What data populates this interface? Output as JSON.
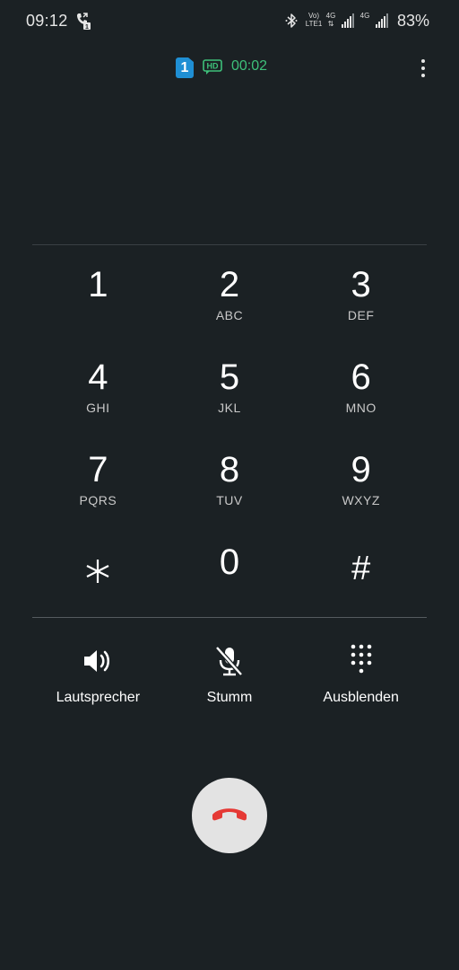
{
  "status_bar": {
    "time": "09:12",
    "volte_line1": "Vo)",
    "volte_line2": "LTE1",
    "network_1": "4G",
    "network_2": "4G",
    "battery": "83%",
    "icons": [
      "call-forward-icon",
      "bluetooth-icon",
      "signal-icon",
      "signal-icon"
    ]
  },
  "call": {
    "sim": "1",
    "hd_label": "HD",
    "timer": "00:02",
    "colors": {
      "timer": "#3ec07a",
      "sim_badge": "#1f8fd4",
      "end_call_icon": "#e53935",
      "end_call_bg": "#e3e3e3",
      "background": "#1b2124"
    }
  },
  "keypad": {
    "keys": [
      {
        "digit": "1",
        "letters": ""
      },
      {
        "digit": "2",
        "letters": "ABC"
      },
      {
        "digit": "3",
        "letters": "DEF"
      },
      {
        "digit": "4",
        "letters": "GHI"
      },
      {
        "digit": "5",
        "letters": "JKL"
      },
      {
        "digit": "6",
        "letters": "MNO"
      },
      {
        "digit": "7",
        "letters": "PQRS"
      },
      {
        "digit": "8",
        "letters": "TUV"
      },
      {
        "digit": "9",
        "letters": "WXYZ"
      },
      {
        "digit": "*",
        "letters": ""
      },
      {
        "digit": "0",
        "letters": ""
      },
      {
        "digit": "#",
        "letters": ""
      }
    ]
  },
  "actions": {
    "speaker": {
      "label": "Lautsprecher",
      "icon": "speaker-icon"
    },
    "mute": {
      "label": "Stumm",
      "icon": "mic-off-icon"
    },
    "hide": {
      "label": "Ausblenden",
      "icon": "dialpad-icon"
    }
  },
  "end_call": {
    "icon": "end-call-icon"
  }
}
